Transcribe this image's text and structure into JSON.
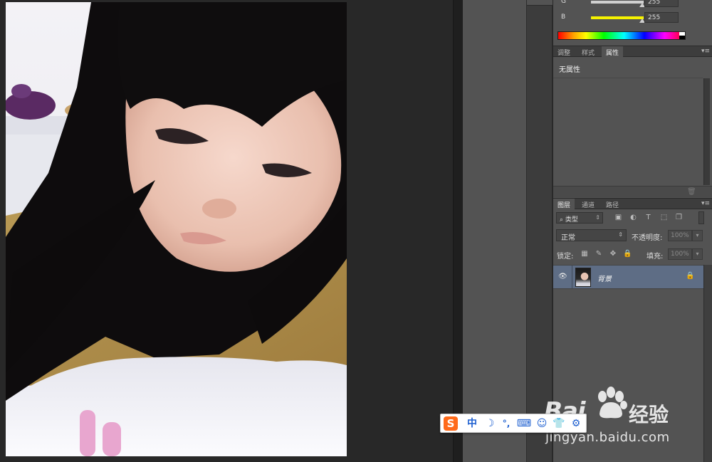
{
  "color_panel": {
    "channels": [
      {
        "label": "G",
        "value": "255",
        "track_color": "#dcdcdc"
      },
      {
        "label": "B",
        "value": "255",
        "track_color": "#f5f200"
      }
    ]
  },
  "properties_panel": {
    "tabs": [
      {
        "label": "调整",
        "active": false
      },
      {
        "label": "样式",
        "active": false
      },
      {
        "label": "属性",
        "active": true
      }
    ],
    "menu_glyph": "▾≡",
    "empty_text": "无属性"
  },
  "layers_panel": {
    "tabs": [
      {
        "label": "图层",
        "active": true
      },
      {
        "label": "通道",
        "active": false
      },
      {
        "label": "路径",
        "active": false
      }
    ],
    "menu_glyph": "▾≡",
    "filter_label": "⌕ 类型",
    "blend_mode": "正常",
    "opacity_label": "不透明度:",
    "opacity_value": "100%",
    "lock_label": "锁定:",
    "fill_label": "填充:",
    "fill_value": "100%",
    "layer": {
      "name": "背景",
      "visible": true,
      "locked": true
    }
  },
  "ime_toolbar": {
    "logo": "S",
    "items": [
      "中",
      "☽",
      "°,",
      "⌨",
      "☺",
      "👕",
      "⚙"
    ]
  },
  "watermark": {
    "brand_left": "Bai",
    "brand_right": "经验",
    "url": "jingyan.baidu.com"
  },
  "accent_colors": {
    "selected_layer": "#5e6d85",
    "panel_bg": "#535353",
    "canvas_bg": "#282828"
  }
}
